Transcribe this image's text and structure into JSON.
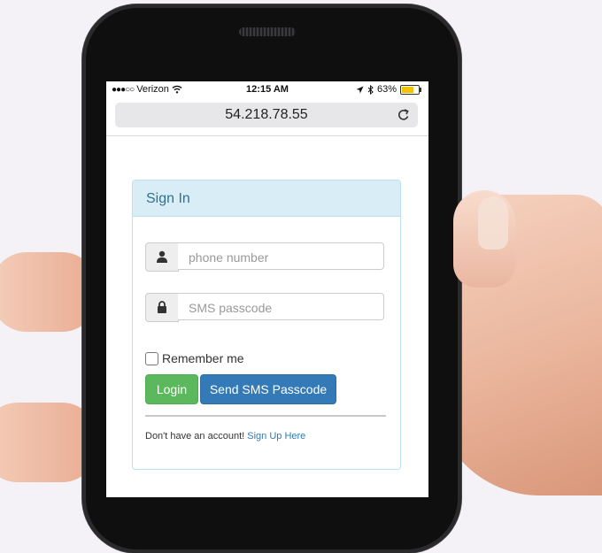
{
  "status_bar": {
    "signal": "●●●○○",
    "carrier": "Verizon",
    "time": "12:15 AM",
    "battery": "63%",
    "battery_level": 0.63,
    "battery_color": "#f5c400"
  },
  "address_bar": {
    "url": "54.218.78.55",
    "reload_icon": "reload-icon"
  },
  "panel": {
    "title": "Sign In",
    "phone_field": {
      "placeholder": "phone number",
      "icon": "user-icon"
    },
    "passcode_field": {
      "placeholder": "SMS passcode",
      "icon": "lock-icon"
    },
    "remember_label": "Remember me",
    "remember_checked": false,
    "login_label": "Login",
    "send_sms_label": "Send SMS Passcode",
    "signup_prompt": "Don't have an account!",
    "signup_link": "Sign Up Here"
  },
  "colors": {
    "heading_bg": "#d9edf7",
    "heading_text": "#31708f",
    "login_green": "#5cb85c",
    "primary_blue": "#337ab7"
  }
}
